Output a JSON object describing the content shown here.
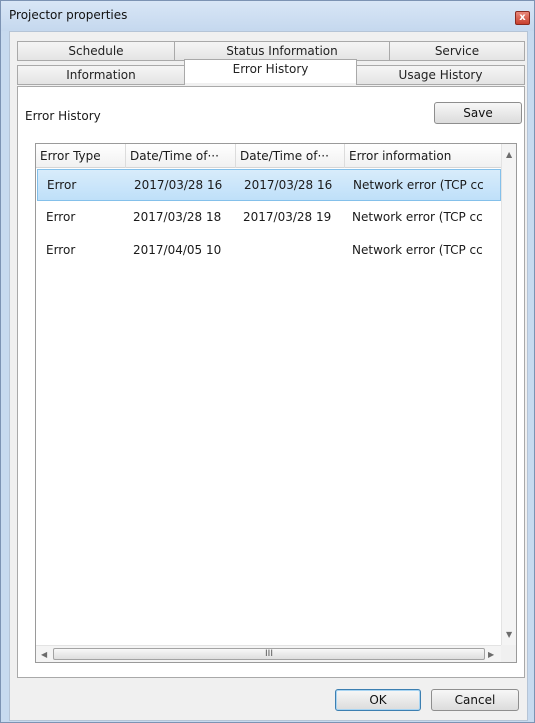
{
  "window": {
    "title": "Projector properties",
    "close_label": "x"
  },
  "tabs_back": [
    "Schedule",
    "Status Information",
    "Service"
  ],
  "tabs_front": [
    "Information",
    "Error History",
    "Usage History"
  ],
  "panel": {
    "label": "Error History",
    "save_label": "Save"
  },
  "table": {
    "columns": [
      "Error Type",
      "Date/Time of···",
      "Date/Time of···",
      "Error information"
    ],
    "rows": [
      [
        "Error",
        "2017/03/28 16",
        "2017/03/28 16",
        "Network error (TCP cc"
      ],
      [
        "Error",
        "2017/03/28 18",
        "2017/03/28 19",
        "Network error (TCP cc"
      ],
      [
        "Error",
        "2017/04/05 10",
        "",
        "Network error (TCP cc"
      ]
    ],
    "selected_row": 0,
    "scroll_thumb_label": "III"
  },
  "footer": {
    "ok_label": "OK",
    "cancel_label": "Cancel"
  }
}
